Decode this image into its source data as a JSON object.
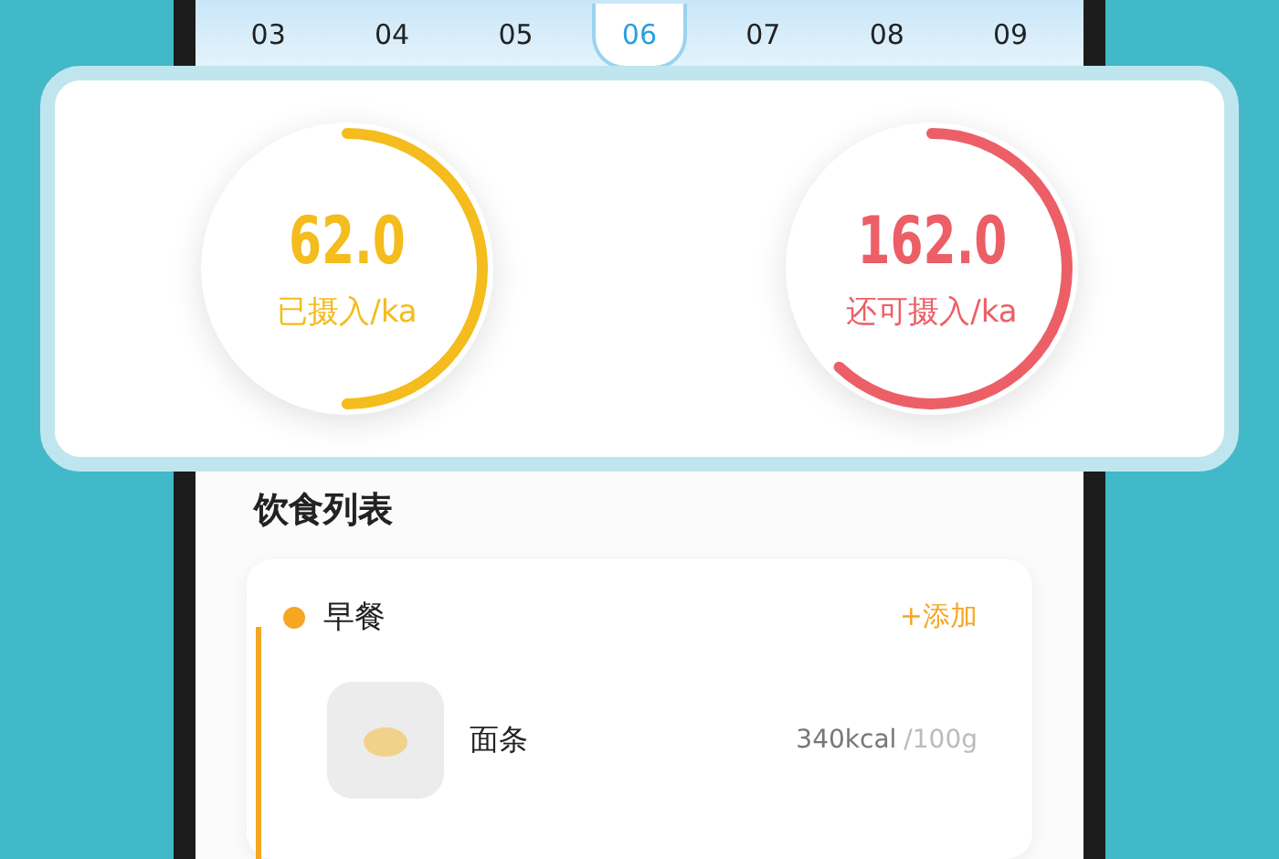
{
  "dates": [
    {
      "label": "03",
      "selected": false
    },
    {
      "label": "04",
      "selected": false
    },
    {
      "label": "05",
      "selected": false
    },
    {
      "label": "06",
      "selected": true
    },
    {
      "label": "07",
      "selected": false
    },
    {
      "label": "08",
      "selected": false
    },
    {
      "label": "09",
      "selected": false
    }
  ],
  "rings": [
    {
      "value": "62.0",
      "label": "已摄入/ka",
      "level": 0.5,
      "color": "#f4bc1c"
    },
    {
      "value": "162.0",
      "label": "还可摄入/ka",
      "level": 0.62,
      "color": "#ec5f67"
    }
  ],
  "diet_list": {
    "title": "饮食列表",
    "meals": [
      {
        "name": "早餐",
        "add": "+添加",
        "foods": [
          {
            "name": "面条",
            "kcal": "340kcal",
            "portion": "/100g"
          }
        ]
      }
    ]
  }
}
